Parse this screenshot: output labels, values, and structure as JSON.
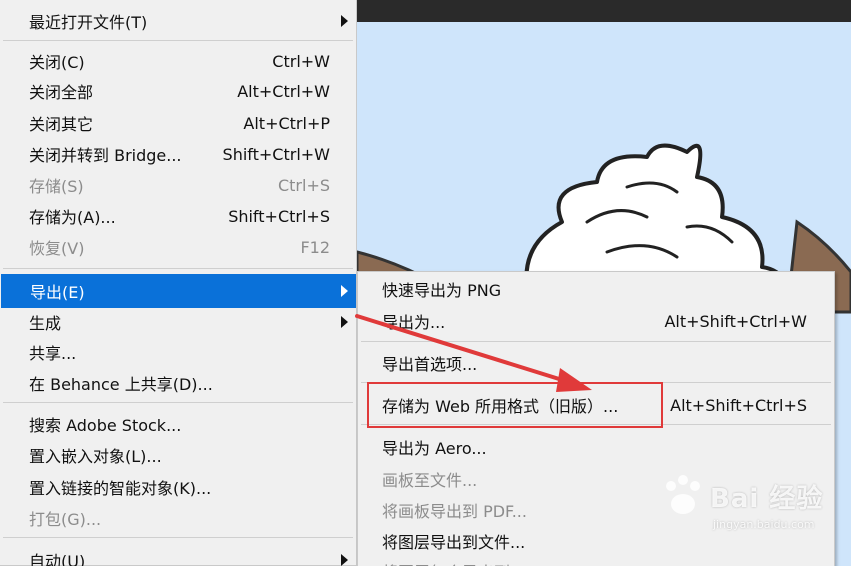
{
  "file_menu": {
    "items": [
      {
        "label": "最近打开文件(T)",
        "shortcut": "",
        "submenu": true,
        "disabled": false,
        "active": false
      },
      {
        "label": "关闭(C)",
        "shortcut": "Ctrl+W",
        "submenu": false,
        "disabled": false,
        "active": false
      },
      {
        "label": "关闭全部",
        "shortcut": "Alt+Ctrl+W",
        "submenu": false,
        "disabled": false,
        "active": false
      },
      {
        "label": "关闭其它",
        "shortcut": "Alt+Ctrl+P",
        "submenu": false,
        "disabled": false,
        "active": false
      },
      {
        "label": "关闭并转到 Bridge...",
        "shortcut": "Shift+Ctrl+W",
        "submenu": false,
        "disabled": false,
        "active": false
      },
      {
        "label": "存储(S)",
        "shortcut": "Ctrl+S",
        "submenu": false,
        "disabled": true,
        "active": false
      },
      {
        "label": "存储为(A)...",
        "shortcut": "Shift+Ctrl+S",
        "submenu": false,
        "disabled": false,
        "active": false
      },
      {
        "label": "恢复(V)",
        "shortcut": "F12",
        "submenu": false,
        "disabled": true,
        "active": false
      },
      {
        "label": "导出(E)",
        "shortcut": "",
        "submenu": true,
        "disabled": false,
        "active": true
      },
      {
        "label": "生成",
        "shortcut": "",
        "submenu": true,
        "disabled": false,
        "active": false
      },
      {
        "label": "共享...",
        "shortcut": "",
        "submenu": false,
        "disabled": false,
        "active": false
      },
      {
        "label": "在 Behance 上共享(D)...",
        "shortcut": "",
        "submenu": false,
        "disabled": false,
        "active": false
      },
      {
        "label": "搜索 Adobe Stock...",
        "shortcut": "",
        "submenu": false,
        "disabled": false,
        "active": false
      },
      {
        "label": "置入嵌入对象(L)...",
        "shortcut": "",
        "submenu": false,
        "disabled": false,
        "active": false
      },
      {
        "label": "置入链接的智能对象(K)...",
        "shortcut": "",
        "submenu": false,
        "disabled": false,
        "active": false
      },
      {
        "label": "打包(G)...",
        "shortcut": "",
        "submenu": false,
        "disabled": true,
        "active": false
      },
      {
        "label": "自动(U)",
        "shortcut": "",
        "submenu": true,
        "disabled": false,
        "active": false
      }
    ]
  },
  "export_menu": {
    "items": [
      {
        "label": "快速导出为 PNG",
        "shortcut": "",
        "disabled": false
      },
      {
        "label": "导出为...",
        "shortcut": "Alt+Shift+Ctrl+W",
        "disabled": false
      },
      {
        "label": "导出首选项...",
        "shortcut": "",
        "disabled": false
      },
      {
        "label": "存储为 Web 所用格式（旧版）...",
        "shortcut": "Alt+Shift+Ctrl+S",
        "disabled": false
      },
      {
        "label": "导出为 Aero...",
        "shortcut": "",
        "disabled": false
      },
      {
        "label": "画板至文件...",
        "shortcut": "",
        "disabled": true
      },
      {
        "label": "将画板导出到 PDF...",
        "shortcut": "",
        "disabled": true
      },
      {
        "label": "将图层导出到文件...",
        "shortcut": "",
        "disabled": false
      },
      {
        "label": "将图层复合导出到 PDF...",
        "shortcut": "",
        "disabled": true
      }
    ]
  },
  "watermark": {
    "text": "Bai  经验",
    "sub": "jingyan.baidu.com"
  },
  "colors": {
    "menu_bg": "#f0f0f0",
    "active_bg": "#0a71d9",
    "highlight_red": "#e03a3a",
    "disabled_text": "#8c8c8c"
  }
}
